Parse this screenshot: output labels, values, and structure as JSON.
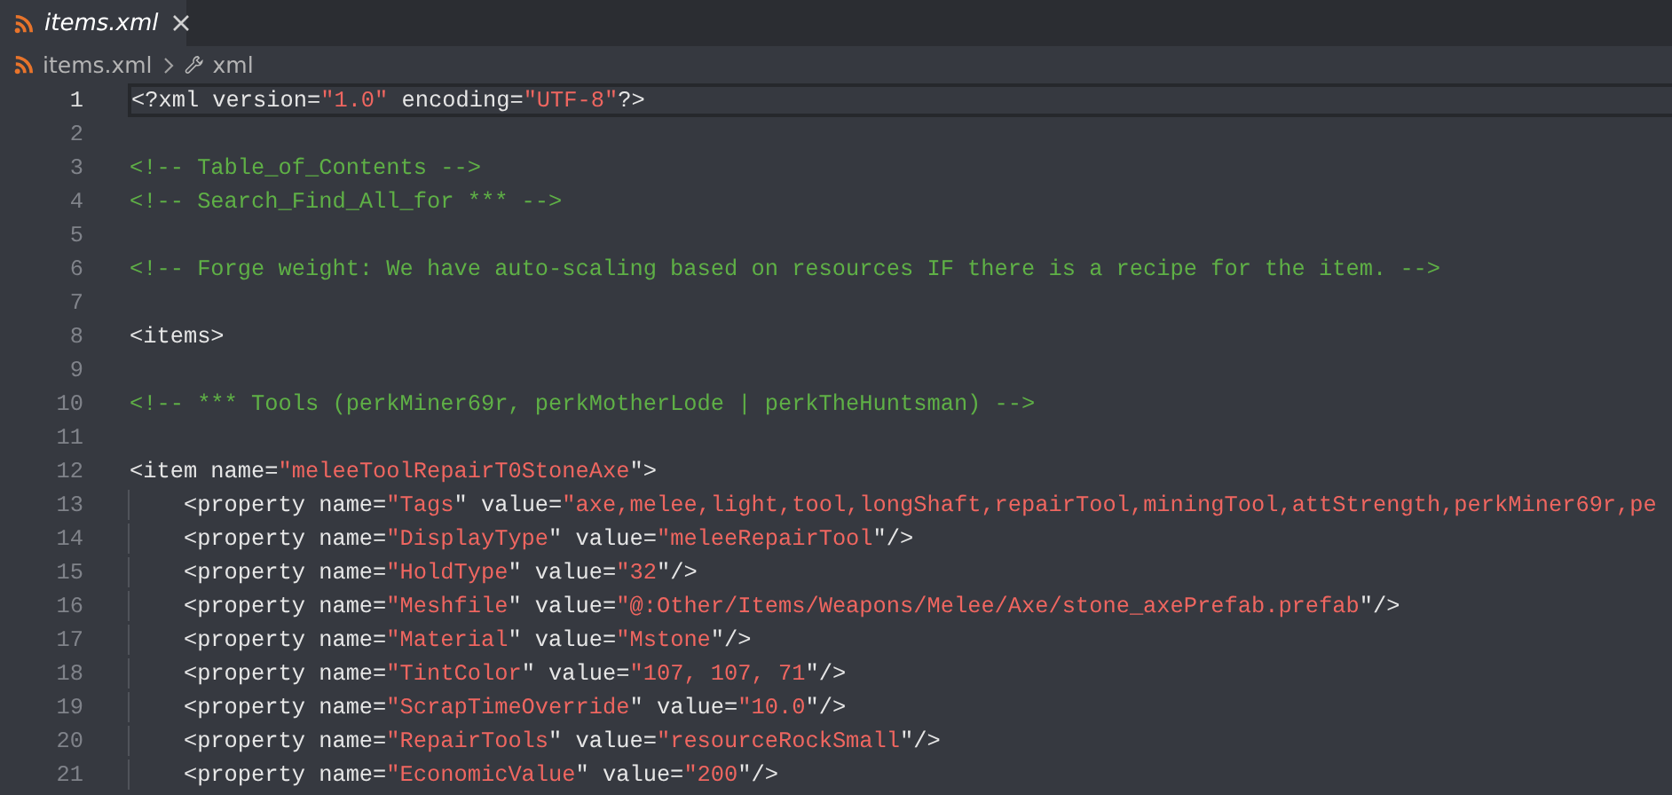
{
  "tab": {
    "label": "items.xml",
    "selected": true
  },
  "breadcrumb": [
    {
      "kind": "file",
      "label": "items.xml"
    },
    {
      "kind": "symbol",
      "label": "xml"
    }
  ],
  "lines": [
    {
      "number": "1",
      "current": true,
      "guide": false,
      "tokens": [
        {
          "kind": "plain",
          "text": "<?xml version="
        },
        {
          "kind": "string",
          "text": "\"1.0\""
        },
        {
          "kind": "plain",
          "text": " encoding="
        },
        {
          "kind": "string",
          "text": "\"UTF-8\""
        },
        {
          "kind": "plain",
          "text": "?>"
        }
      ]
    },
    {
      "number": "2"
    },
    {
      "number": "3",
      "current": false,
      "guide": false,
      "tokens": [
        {
          "kind": "comment",
          "text": "<!-- Table_of_Contents -->"
        }
      ]
    },
    {
      "number": "4",
      "current": false,
      "guide": false,
      "tokens": [
        {
          "kind": "comment",
          "text": "<!-- Search_Find_All_for *** -->"
        }
      ]
    },
    {
      "number": "5"
    },
    {
      "number": "6",
      "current": false,
      "guide": false,
      "tokens": [
        {
          "kind": "comment",
          "text": "<!-- Forge weight: We have auto-scaling based on resources IF there is a recipe for the item. -->"
        }
      ]
    },
    {
      "number": "7"
    },
    {
      "number": "8",
      "current": false,
      "guide": false,
      "tokens": [
        {
          "kind": "plain",
          "text": "<items>"
        }
      ]
    },
    {
      "number": "9"
    },
    {
      "number": "10",
      "current": false,
      "guide": false,
      "tokens": [
        {
          "kind": "comment",
          "text": "<!-- *** Tools (perkMiner69r, perkMotherLode | perkTheHuntsman) -->"
        }
      ]
    },
    {
      "number": "11"
    },
    {
      "number": "12",
      "current": false,
      "guide": false,
      "tokens": [
        {
          "kind": "plain",
          "text": "<item name="
        },
        {
          "kind": "string",
          "text": "\"meleeToolRepairT0StoneAxe"
        },
        {
          "kind": "plain",
          "text": "\">"
        }
      ]
    },
    {
      "number": "13",
      "current": false,
      "guide": true,
      "tokens": [
        {
          "kind": "plain",
          "text": "    <property name="
        },
        {
          "kind": "string",
          "text": "\"Tags"
        },
        {
          "kind": "plain",
          "text": "\" value="
        },
        {
          "kind": "string",
          "text": "\"axe,melee,light,tool,longShaft,repairTool,miningTool,attStrength,perkMiner69r,pe"
        }
      ]
    },
    {
      "number": "14",
      "current": false,
      "guide": true,
      "tokens": [
        {
          "kind": "plain",
          "text": "    <property name="
        },
        {
          "kind": "string",
          "text": "\"DisplayType"
        },
        {
          "kind": "plain",
          "text": "\" value="
        },
        {
          "kind": "string",
          "text": "\"meleeRepairTool"
        },
        {
          "kind": "plain",
          "text": "\"/>"
        }
      ]
    },
    {
      "number": "15",
      "current": false,
      "guide": true,
      "tokens": [
        {
          "kind": "plain",
          "text": "    <property name="
        },
        {
          "kind": "string",
          "text": "\"HoldType"
        },
        {
          "kind": "plain",
          "text": "\" value="
        },
        {
          "kind": "string",
          "text": "\"32"
        },
        {
          "kind": "plain",
          "text": "\"/>"
        }
      ]
    },
    {
      "number": "16",
      "current": false,
      "guide": true,
      "tokens": [
        {
          "kind": "plain",
          "text": "    <property name="
        },
        {
          "kind": "string",
          "text": "\"Meshfile"
        },
        {
          "kind": "plain",
          "text": "\" value="
        },
        {
          "kind": "string",
          "text": "\"@:Other/Items/Weapons/Melee/Axe/stone_axePrefab.prefab"
        },
        {
          "kind": "plain",
          "text": "\"/>"
        }
      ]
    },
    {
      "number": "17",
      "current": false,
      "guide": true,
      "tokens": [
        {
          "kind": "plain",
          "text": "    <property name="
        },
        {
          "kind": "string",
          "text": "\"Material"
        },
        {
          "kind": "plain",
          "text": "\" value="
        },
        {
          "kind": "string",
          "text": "\"Mstone"
        },
        {
          "kind": "plain",
          "text": "\"/>"
        }
      ]
    },
    {
      "number": "18",
      "current": false,
      "guide": true,
      "tokens": [
        {
          "kind": "plain",
          "text": "    <property name="
        },
        {
          "kind": "string",
          "text": "\"TintColor"
        },
        {
          "kind": "plain",
          "text": "\" value="
        },
        {
          "kind": "string",
          "text": "\"107, 107, 71"
        },
        {
          "kind": "plain",
          "text": "\"/>"
        }
      ]
    },
    {
      "number": "19",
      "current": false,
      "guide": true,
      "tokens": [
        {
          "kind": "plain",
          "text": "    <property name="
        },
        {
          "kind": "string",
          "text": "\"ScrapTimeOverride"
        },
        {
          "kind": "plain",
          "text": "\" value="
        },
        {
          "kind": "string",
          "text": "\"10.0"
        },
        {
          "kind": "plain",
          "text": "\"/>"
        }
      ]
    },
    {
      "number": "20",
      "current": false,
      "guide": true,
      "tokens": [
        {
          "kind": "plain",
          "text": "    <property name="
        },
        {
          "kind": "string",
          "text": "\"RepairTools"
        },
        {
          "kind": "plain",
          "text": "\" value="
        },
        {
          "kind": "string",
          "text": "\"resourceRockSmall"
        },
        {
          "kind": "plain",
          "text": "\"/>"
        }
      ]
    },
    {
      "number": "21",
      "current": false,
      "guide": true,
      "tokens": [
        {
          "kind": "plain",
          "text": "    <property name="
        },
        {
          "kind": "string",
          "text": "\"EconomicValue"
        },
        {
          "kind": "plain",
          "text": "\" value="
        },
        {
          "kind": "string",
          "text": "\"200"
        },
        {
          "kind": "plain",
          "text": "\"/>"
        }
      ]
    }
  ]
}
